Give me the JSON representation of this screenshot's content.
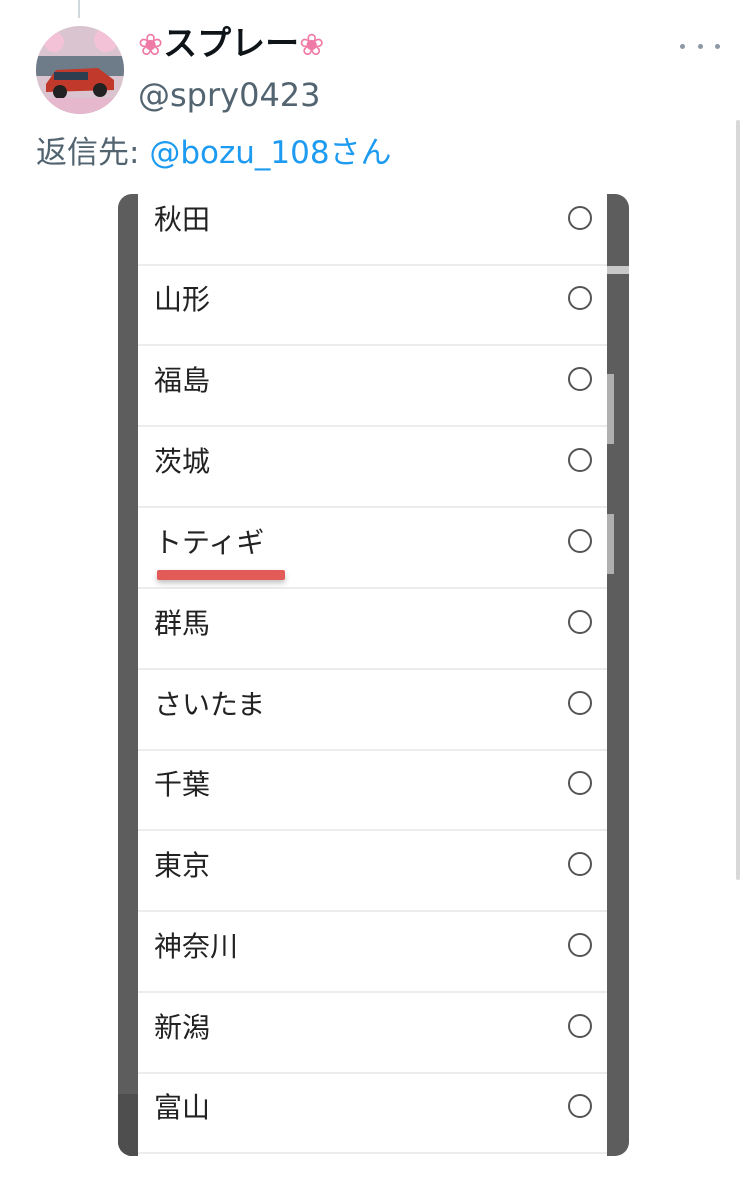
{
  "tweet": {
    "display_name_text": "スプレー",
    "handle": "@spry0423",
    "reply_prefix": "返信先: ",
    "reply_mention": "@bozu_108さん"
  },
  "list": {
    "items": [
      {
        "label": "秋田",
        "selected": false
      },
      {
        "label": "山形",
        "selected": false
      },
      {
        "label": "福島",
        "selected": false
      },
      {
        "label": "茨城",
        "selected": false
      },
      {
        "label": "トティギ",
        "selected": false
      },
      {
        "label": "群馬",
        "selected": false
      },
      {
        "label": "さいたま",
        "selected": false
      },
      {
        "label": "千葉",
        "selected": false
      },
      {
        "label": "東京",
        "selected": false
      },
      {
        "label": "神奈川",
        "selected": false
      },
      {
        "label": "新潟",
        "selected": false
      },
      {
        "label": "富山",
        "selected": false
      }
    ]
  },
  "icons": {
    "blossom": "cherry-blossom-icon",
    "more": "more-icon",
    "radio": "radio-icon"
  },
  "colors": {
    "accent": "#1d9bf0",
    "highlight": "#e25b58"
  }
}
